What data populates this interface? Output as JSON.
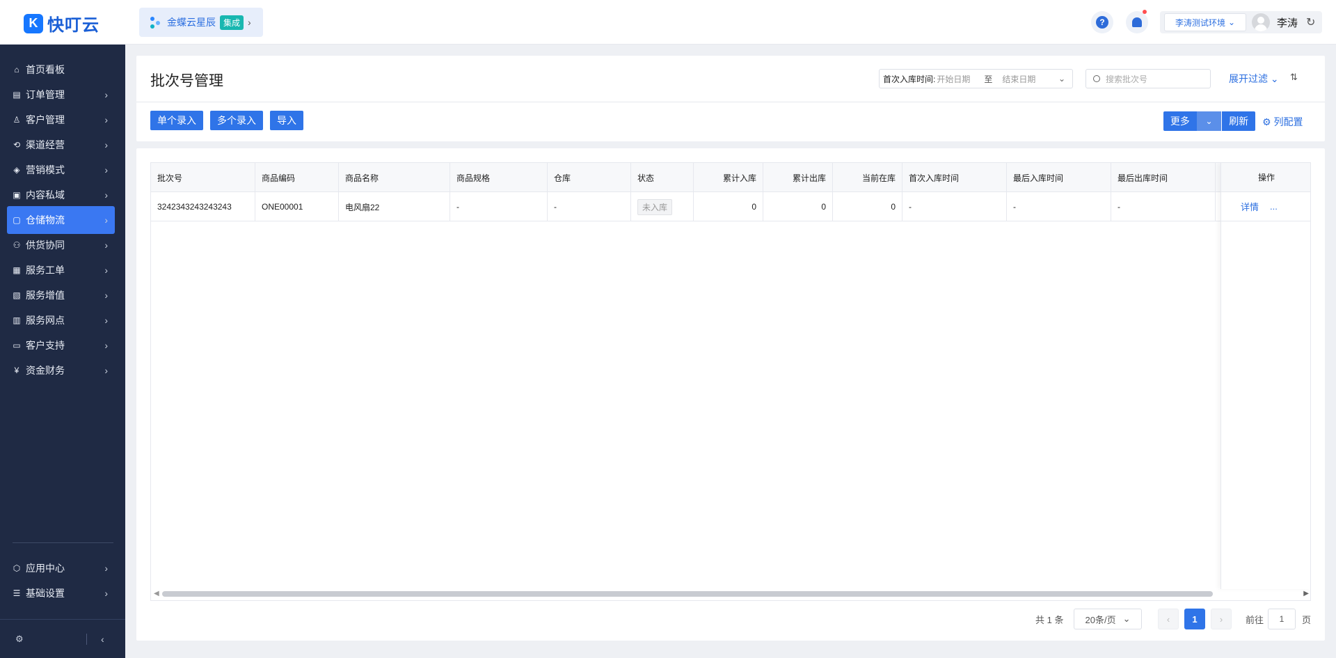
{
  "app": {
    "logo_text": "快叮云",
    "integration": {
      "label": "金蝶云星辰",
      "badge": "集成"
    }
  },
  "header": {
    "help_label": "?",
    "env_select": "李涛测试环境",
    "user_name": "李涛"
  },
  "sidebar": {
    "items": [
      {
        "label": "首页看板",
        "icon": "home-icon",
        "has_children": false
      },
      {
        "label": "订单管理",
        "icon": "order-icon",
        "has_children": true
      },
      {
        "label": "客户管理",
        "icon": "user-icon",
        "has_children": true
      },
      {
        "label": "渠道经营",
        "icon": "channel-icon",
        "has_children": true
      },
      {
        "label": "营销模式",
        "icon": "tag-icon",
        "has_children": true
      },
      {
        "label": "内容私域",
        "icon": "image-icon",
        "has_children": true
      },
      {
        "label": "仓储物流",
        "icon": "warehouse-icon",
        "has_children": true,
        "active": true
      },
      {
        "label": "供货协同",
        "icon": "supply-icon",
        "has_children": true
      },
      {
        "label": "服务工单",
        "icon": "ticket-icon",
        "has_children": true
      },
      {
        "label": "服务增值",
        "icon": "bag-icon",
        "has_children": true
      },
      {
        "label": "服务网点",
        "icon": "store-icon",
        "has_children": true
      },
      {
        "label": "客户支持",
        "icon": "support-icon",
        "has_children": true
      },
      {
        "label": "资金财务",
        "icon": "yuan-icon",
        "has_children": true
      }
    ],
    "bottom_items": [
      {
        "label": "应用中心",
        "icon": "app-center-icon"
      },
      {
        "label": "基础设置",
        "icon": "settings-list-icon"
      }
    ]
  },
  "page": {
    "title": "批次号管理",
    "filters": {
      "date_label": "首次入库时间:",
      "date_start_placeholder": "开始日期",
      "date_to": "至",
      "date_end_placeholder": "结束日期",
      "search_placeholder": "搜索批次号",
      "expand_filter": "展开过滤"
    },
    "toolbar": {
      "single_entry": "单个录入",
      "multi_entry": "多个录入",
      "import": "导入",
      "more": "更多",
      "refresh": "刷新",
      "column_config": "列配置"
    }
  },
  "table": {
    "columns": [
      "批次号",
      "商品编码",
      "商品名称",
      "商品规格",
      "仓库",
      "状态",
      "累计入库",
      "累计出库",
      "当前在库",
      "首次入库时间",
      "最后入库时间",
      "最后出库时间"
    ],
    "op_column": "操作",
    "rows": [
      {
        "batch_no": "3242343243243243",
        "product_code": "ONE00001",
        "product_name": "电风扇22",
        "spec": "-",
        "warehouse": "-",
        "status": "未入库",
        "total_in": "0",
        "total_out": "0",
        "in_stock": "0",
        "first_in_time": "-",
        "last_in_time": "-",
        "last_out_time": "-",
        "op_detail": "详情",
        "op_more": "..."
      }
    ]
  },
  "pagination": {
    "total": "共 1 条",
    "page_size": "20条/页",
    "current_page": "1",
    "goto_label": "前往",
    "goto_value": "1",
    "page_unit": "页"
  },
  "colors": {
    "primary": "#2f74e8",
    "sidebar_bg": "#1f2a44",
    "active_nav": "#3a78f2"
  }
}
